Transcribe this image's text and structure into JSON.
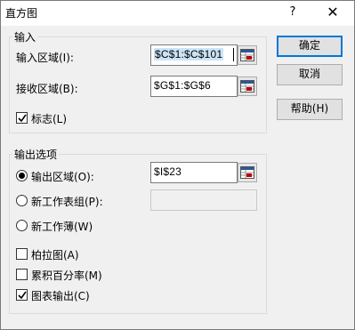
{
  "dialog": {
    "title": "直方图",
    "help_glyph": "?",
    "close_glyph": "✕"
  },
  "input_group": {
    "title": "输入",
    "input_range": {
      "label": "输入区域(I):",
      "value": "$C$1:$C$101"
    },
    "bin_range": {
      "label": "接收区域(B):",
      "value": "$G$1:$G$6"
    },
    "labels": {
      "label": "标志(L)",
      "checked": true
    }
  },
  "output_group": {
    "title": "输出选项",
    "output_range": {
      "label": "输出区域(O):",
      "value": "$I$23",
      "selected": true
    },
    "new_worksheet": {
      "label": "新工作表组(P):",
      "value": "",
      "selected": false
    },
    "new_workbook": {
      "label": "新工作薄(W)",
      "selected": false
    },
    "pareto": {
      "label": "柏拉图(A)",
      "checked": false
    },
    "cumulative": {
      "label": "累积百分率(M)",
      "checked": false
    },
    "chart_output": {
      "label": "图表输出(C)",
      "checked": true
    }
  },
  "buttons": {
    "ok": "确定",
    "cancel": "取消",
    "help": "帮助(H)"
  },
  "icons": {
    "collapse_dialog": "range-selector-icon",
    "check": "check-mark-icon"
  }
}
